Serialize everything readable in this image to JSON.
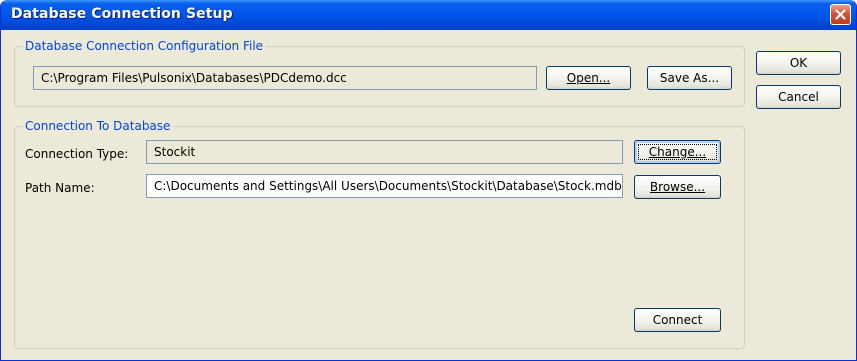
{
  "window": {
    "title": "Database Connection Setup"
  },
  "config_file_group": {
    "title": "Database Connection Configuration File",
    "path_value": "C:\\Program Files\\Pulsonix\\Databases\\PDCdemo.dcc",
    "open_label": "Open...",
    "save_as_label": "Save As..."
  },
  "connection_group": {
    "title": "Connection To Database",
    "connection_type_label": "Connection Type:",
    "connection_type_value": "Stockit",
    "change_label": "Change...",
    "path_name_label": "Path Name:",
    "path_name_value": "C:\\Documents and Settings\\All Users\\Documents\\Stockit\\Database\\Stock.mdb",
    "browse_label": "Browse...",
    "connect_label": "Connect"
  },
  "dialog_buttons": {
    "ok_label": "OK",
    "cancel_label": "Cancel"
  },
  "icons": {
    "close": "close-icon"
  },
  "colors": {
    "titlebar": "#0058ee",
    "group_title": "#0046d5",
    "dialog_bg": "#ece9d8",
    "close_button": "#d8553a"
  }
}
